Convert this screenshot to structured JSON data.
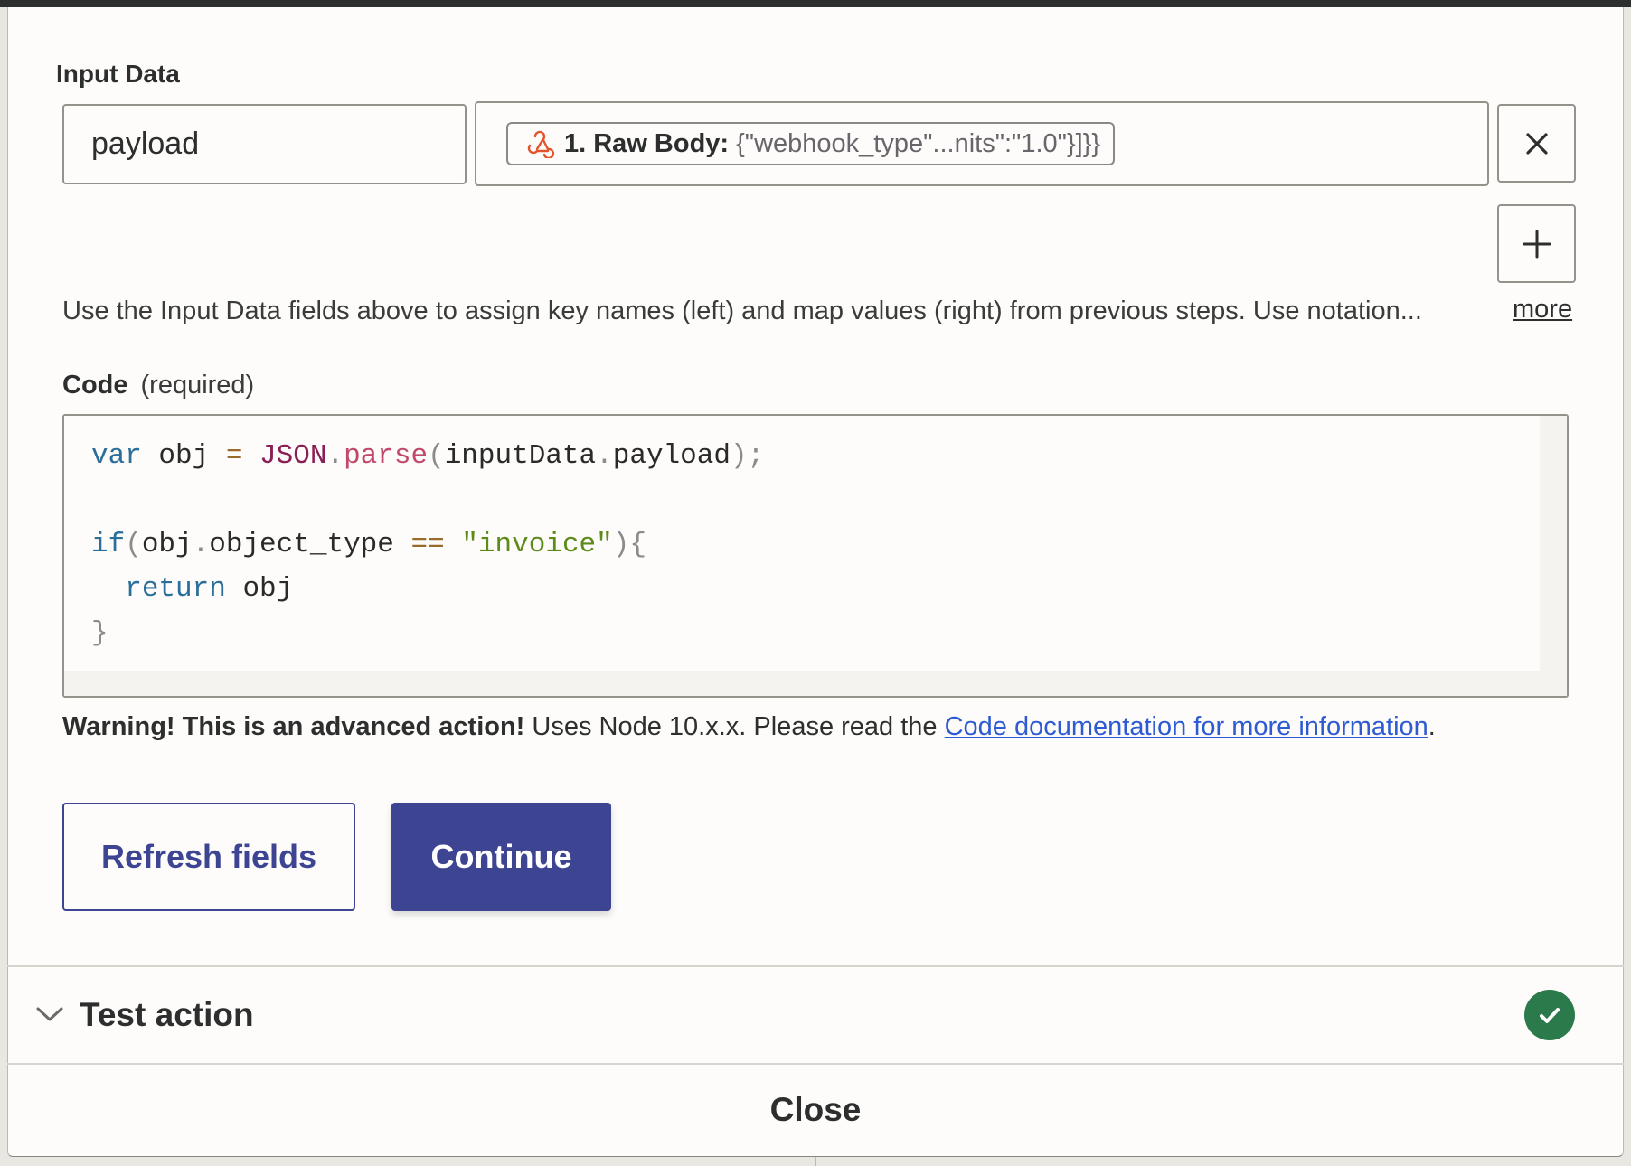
{
  "input_data": {
    "label": "Input Data",
    "key_value": "payload",
    "mapped_label": "1. Raw Body:",
    "mapped_value": "{\"webhook_type\"...nits\":\"1.0\"}]}}",
    "help_text": "Use the Input Data fields above to assign key names (left) and map values (right) from previous steps. Use notation...",
    "more_label": "more"
  },
  "code": {
    "label": "Code",
    "required_label": "(required)"
  },
  "warning": {
    "bold": "Warning! This is an advanced action!",
    "text": " Uses Node 10.x.x. Please read the ",
    "link": "Code documentation for more information",
    "end": "."
  },
  "buttons": {
    "refresh": "Refresh fields",
    "continue": "Continue",
    "close": "Close"
  },
  "test_section": {
    "title": "Test action",
    "status": "success"
  },
  "colors": {
    "primary": "#3d4592",
    "success": "#2b7a4b",
    "link": "#2e5bd1",
    "webhook_icon": "#e3542c"
  }
}
